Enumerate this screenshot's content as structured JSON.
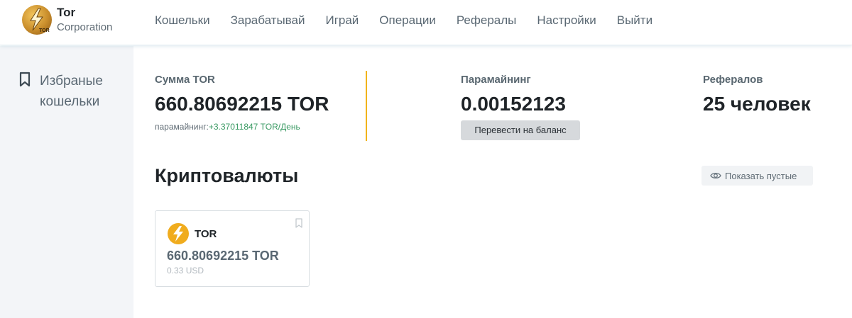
{
  "brand": {
    "title": "Tor",
    "subtitle": "Corporation",
    "logo_text": "TOR"
  },
  "nav": [
    {
      "label": "Кошельки"
    },
    {
      "label": "Зарабатывай"
    },
    {
      "label": "Играй"
    },
    {
      "label": "Операции"
    },
    {
      "label": "Рефералы"
    },
    {
      "label": "Настройки"
    },
    {
      "label": "Выйти"
    }
  ],
  "sidebar": {
    "favorites_label": "Избраные кошельки",
    "icon": "bookmark-icon"
  },
  "stats": {
    "total": {
      "label": "Сумма TOR",
      "value": "660.80692215 TOR",
      "mining_prefix": "парамайнинг:",
      "mining_rate": "+3.37011847 TOR/День"
    },
    "paramining": {
      "label": "Парамайнинг",
      "value": "0.00152123",
      "button": "Перевести на баланс"
    },
    "referrals": {
      "label": "Рефералов",
      "value": "25 человек"
    }
  },
  "crypto": {
    "title": "Криптовалюты",
    "show_empty": "Показать пустые",
    "cards": [
      {
        "name": "TOR",
        "amount": "660.80692215 TOR",
        "usd": "0.33 USD"
      }
    ]
  },
  "colors": {
    "accent": "#f1b41b",
    "green": "#3a9a63",
    "coin": "#f0ac1e"
  }
}
